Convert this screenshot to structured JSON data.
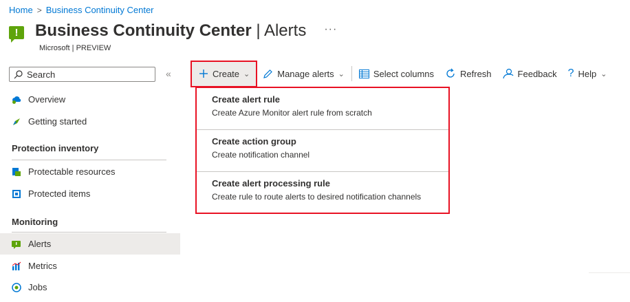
{
  "breadcrumb": {
    "home": "Home",
    "separator": ">",
    "current": "Business Continuity Center"
  },
  "header": {
    "title_strong": "Business Continuity Center",
    "title_sep": " | ",
    "title_thin": "Alerts",
    "more": "···",
    "subtitle": "Microsoft | PREVIEW"
  },
  "sidebar": {
    "search_placeholder": "Search",
    "collapse": "«",
    "overview": "Overview",
    "getting_started": "Getting started",
    "protection_inventory": "Protection inventory",
    "protectable_resources": "Protectable resources",
    "protected_items": "Protected items",
    "monitoring": "Monitoring",
    "alerts": "Alerts",
    "metrics": "Metrics",
    "jobs": "Jobs"
  },
  "toolbar": {
    "create": "Create",
    "manage_alerts": "Manage alerts",
    "select_columns": "Select columns",
    "refresh": "Refresh",
    "feedback": "Feedback",
    "help": "Help"
  },
  "dropdown": {
    "items": [
      {
        "title": "Create alert rule",
        "desc": "Create Azure Monitor alert rule from scratch"
      },
      {
        "title": "Create action group",
        "desc": "Create notification channel"
      },
      {
        "title": "Create alert processing rule",
        "desc": "Create rule to route alerts to desired notification channels"
      }
    ]
  },
  "colors": {
    "accent": "#0078d4",
    "highlight": "#e81123",
    "app_icon": "#5ea40b"
  }
}
